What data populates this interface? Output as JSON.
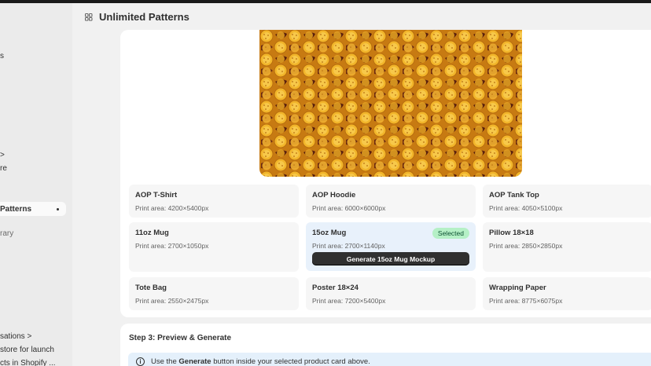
{
  "app": {
    "title": "Unlimited Patterns"
  },
  "sidebar": {
    "items": [
      {
        "label": "s",
        "id": "s"
      },
      {
        "label": ">",
        "id": "chevron"
      },
      {
        "label": "re",
        "id": "re"
      },
      {
        "label": "Patterns",
        "id": "patterns"
      },
      {
        "label": "rary",
        "id": "rary"
      },
      {
        "label": "sations >",
        "id": "sations"
      },
      {
        "label": "store for launch",
        "id": "store-launch"
      },
      {
        "label": "cts in Shopify ...",
        "id": "cts-shopify"
      }
    ]
  },
  "products": [
    {
      "name": "AOP T-Shirt",
      "area": "Print area: 4200×5400px"
    },
    {
      "name": "AOP Hoodie",
      "area": "Print area: 6000×6000px"
    },
    {
      "name": "AOP Tank Top",
      "area": "Print area: 4050×5100px"
    },
    {
      "name": "11oz Mug",
      "area": "Print area: 2700×1050px"
    },
    {
      "name": "15oz Mug",
      "area": "Print area: 2700×1140px",
      "badge": "Selected",
      "button": "Generate 15oz Mug Mockup"
    },
    {
      "name": "Pillow 18×18",
      "area": "Print area: 2850×2850px"
    },
    {
      "name": "Tote Bag",
      "area": "Print area: 2550×2475px"
    },
    {
      "name": "Poster 18×24",
      "area": "Print area: 7200×5400px"
    },
    {
      "name": "Wrapping Paper",
      "area": "Print area: 8775×6075px"
    }
  ],
  "step3": {
    "title": "Step 3: Preview & Generate",
    "banner_pre": "Use the ",
    "banner_bold": "Generate",
    "banner_post": " button inside your selected product card above."
  },
  "colors": {
    "selected_card": "#e8f1fb",
    "badge_bg": "#b5f0c6",
    "button_bg": "#303030",
    "banner_bg": "#e4f0fb",
    "cracker": "#e6a41c",
    "chocolate": "#5a200d"
  }
}
